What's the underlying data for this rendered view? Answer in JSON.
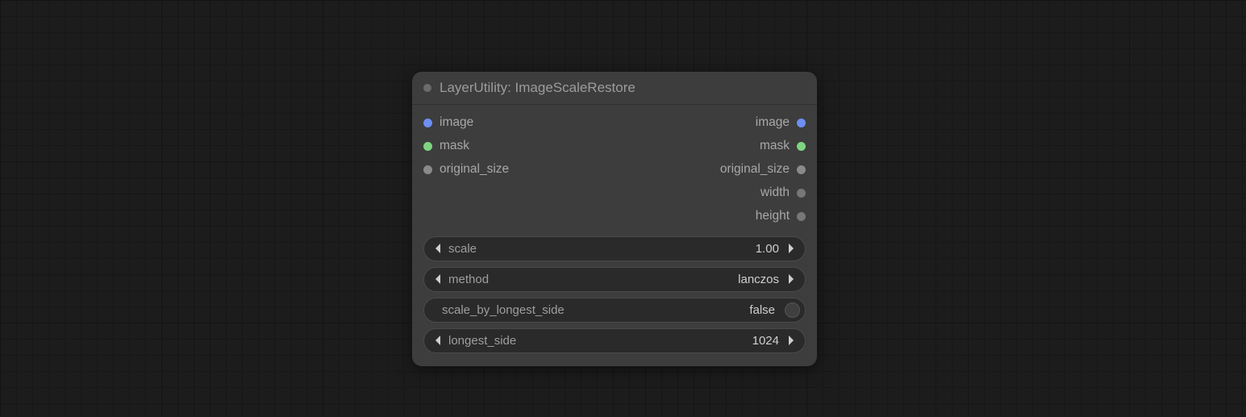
{
  "node": {
    "title": "LayerUtility: ImageScaleRestore",
    "inputs": [
      {
        "label": "image",
        "color": "c-blue"
      },
      {
        "label": "mask",
        "color": "c-green"
      },
      {
        "label": "original_size",
        "color": "c-gray"
      }
    ],
    "outputs": [
      {
        "label": "image",
        "color": "c-blue"
      },
      {
        "label": "mask",
        "color": "c-green"
      },
      {
        "label": "original_size",
        "color": "c-gray"
      },
      {
        "label": "width",
        "color": "c-grayd"
      },
      {
        "label": "height",
        "color": "c-grayd"
      }
    ],
    "widgets": {
      "scale": {
        "label": "scale",
        "value": "1.00"
      },
      "method": {
        "label": "method",
        "value": "lanczos"
      },
      "scale_by_longest_side": {
        "label": "scale_by_longest_side",
        "value": "false"
      },
      "longest_side": {
        "label": "longest_side",
        "value": "1024"
      }
    }
  }
}
